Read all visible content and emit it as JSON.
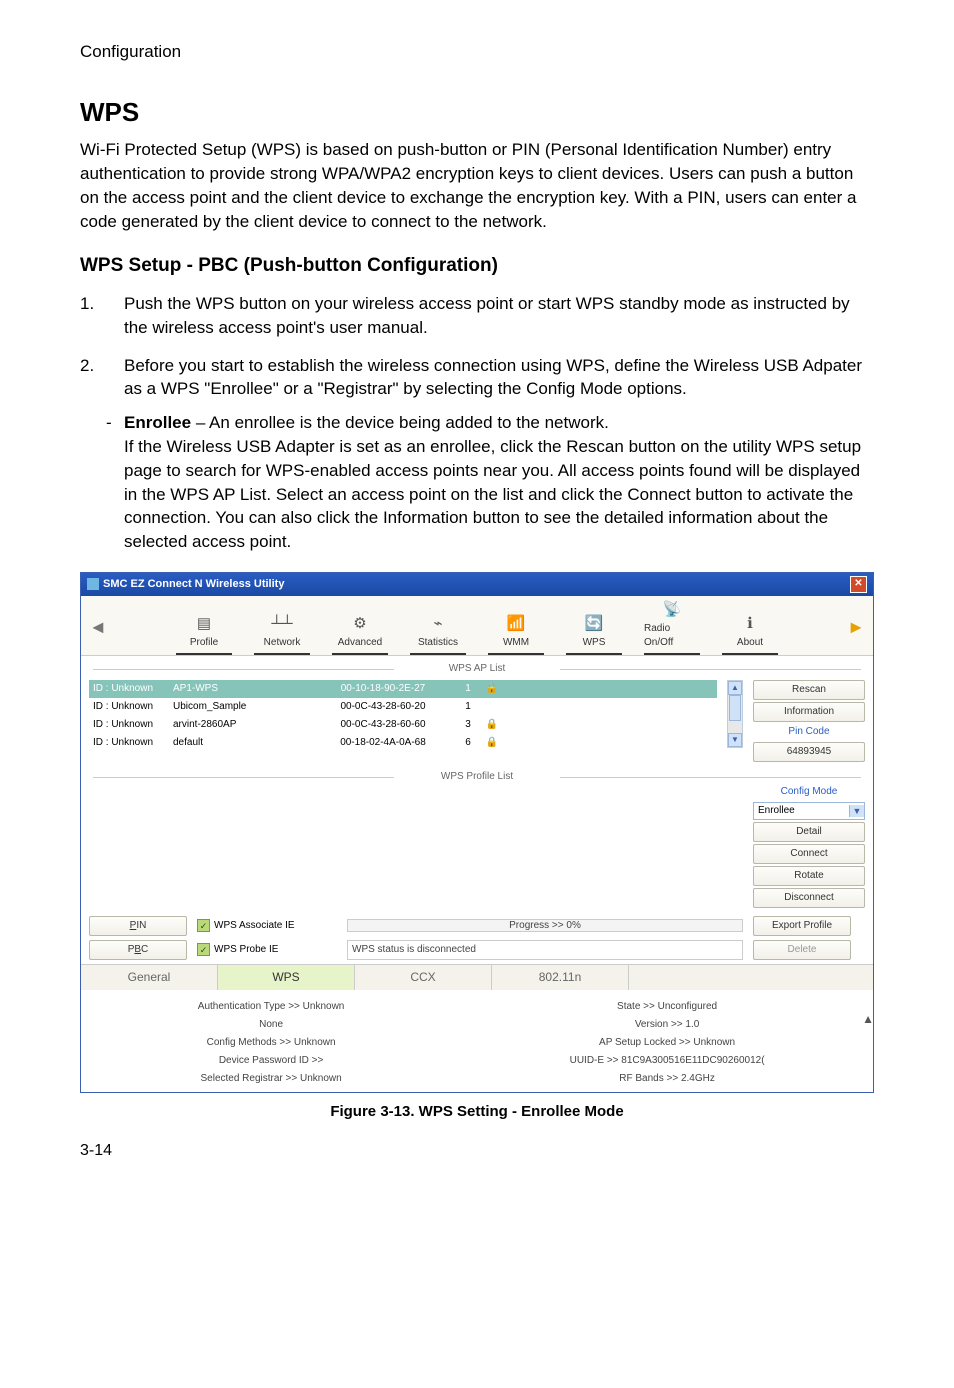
{
  "breadcrumb": "Configuration",
  "h1": "WPS",
  "intro": "Wi-Fi Protected Setup (WPS) is based on push-button or PIN (Personal Identification Number) entry authentication to provide strong WPA/WPA2 encryption keys to client devices. Users can push a button on the access point and the client device to exchange the encryption key. With a PIN, users can enter a code generated by the client device to connect to the network.",
  "h2": "WPS Setup - PBC (Push-button Configuration)",
  "steps": {
    "s1_num": "1.",
    "s1": "Push the WPS button on your wireless access point or start WPS standby mode as instructed by the wireless access point's user manual.",
    "s2_num": "2.",
    "s2": "Before you start to establish the wireless connection using WPS, define the Wireless USB Adpater as a WPS \"Enrollee\" or a \"Registrar\" by selecting the Config Mode options.",
    "sub_dash": "-",
    "sub_bold": "Enrollee",
    "sub_after_bold": " – An enrollee is the device being added to the network.",
    "sub_body": "If the Wireless USB Adapter is set as an enrollee, click the Rescan button on the utility WPS setup page to search for WPS-enabled access points near you. All access points found will be displayed in the WPS AP List. Select an access point on the list and click the Connect button to activate the connection. You can also click the Information button to see the detailed information about the selected access point."
  },
  "window": {
    "title": "SMC EZ Connect N Wireless Utility",
    "close": "✕",
    "tools": {
      "profile": "Profile",
      "network": "Network",
      "advanced": "Advanced",
      "statistics": "Statistics",
      "wmm": "WMM",
      "wps": "WPS",
      "radio": "Radio On/Off",
      "about": "About"
    },
    "ap_list_label": "WPS AP List",
    "ap_rows": [
      {
        "id": "ID : Unknown",
        "ssid": "AP1-WPS",
        "mac": "00-10-18-90-2E-27",
        "ch": "1",
        "lock": true
      },
      {
        "id": "ID : Unknown",
        "ssid": "Ubicom_Sample",
        "mac": "00-0C-43-28-60-20",
        "ch": "1",
        "lock": false
      },
      {
        "id": "ID : Unknown",
        "ssid": "arvint-2860AP",
        "mac": "00-0C-43-28-60-60",
        "ch": "3",
        "lock": true
      },
      {
        "id": "ID : Unknown",
        "ssid": "default",
        "mac": "00-18-02-4A-0A-68",
        "ch": "6",
        "lock": true
      }
    ],
    "btns": {
      "rescan": "Rescan",
      "information": "Information",
      "pincode": "Pin Code",
      "pinvalue": "64893945",
      "configmode": "Config Mode",
      "configvalue": "Enrollee",
      "detail": "Detail",
      "connect": "Connect",
      "rotate": "Rotate",
      "disconnect": "Disconnect",
      "export": "Export Profile",
      "delete": "Delete"
    },
    "profile_list_label": "WPS Profile List",
    "pin": "PIN",
    "pbc": "PBC",
    "chk_assoc": "WPS Associate IE",
    "chk_probe": "WPS Probe IE",
    "progress": "Progress >> 0%",
    "status": "WPS status is disconnected",
    "tabs": {
      "general": "General",
      "wps": "WPS",
      "ccx": "CCX",
      "dot11n": "802.11n"
    },
    "details": {
      "auth": "Authentication Type >> Unknown",
      "state": "State >> Unconfigured",
      "encnone": "None",
      "version": "Version >> 1.0",
      "config": "Config Methods >> Unknown",
      "aplock": "AP Setup Locked >> Unknown",
      "devpwd": "Device Password ID >>",
      "uuid": "UUID-E >> 81C9A300516E11DC90260012(",
      "selreg": "Selected Registrar >> Unknown",
      "rfbands": "RF Bands >> 2.4GHz"
    }
  },
  "caption": "Figure 3-13.  WPS Setting - Enrollee Mode",
  "pagenum": "3-14"
}
